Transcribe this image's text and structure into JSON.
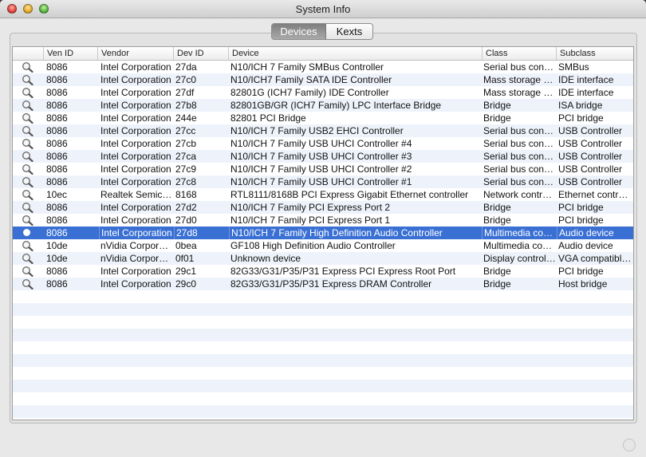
{
  "window": {
    "title": "System Info"
  },
  "tabs": [
    {
      "label": "Devices",
      "active": true
    },
    {
      "label": "Kexts",
      "active": false
    }
  ],
  "table": {
    "columns": [
      "",
      "Ven ID",
      "Vendor",
      "Dev ID",
      "Device",
      "Class",
      "Subclass"
    ],
    "rows": [
      {
        "ven_id": "8086",
        "vendor": "Intel Corporation",
        "dev_id": "27da",
        "device": "N10/ICH 7 Family SMBus Controller",
        "class": "Serial bus controller",
        "subclass": "SMBus"
      },
      {
        "ven_id": "8086",
        "vendor": "Intel Corporation",
        "dev_id": "27c0",
        "device": "N10/ICH7 Family SATA IDE Controller",
        "class": "Mass storage controller",
        "subclass": "IDE interface"
      },
      {
        "ven_id": "8086",
        "vendor": "Intel Corporation",
        "dev_id": "27df",
        "device": "82801G (ICH7 Family) IDE Controller",
        "class": "Mass storage controller",
        "subclass": "IDE interface"
      },
      {
        "ven_id": "8086",
        "vendor": "Intel Corporation",
        "dev_id": "27b8",
        "device": "82801GB/GR (ICH7 Family) LPC Interface Bridge",
        "class": "Bridge",
        "subclass": "ISA bridge"
      },
      {
        "ven_id": "8086",
        "vendor": "Intel Corporation",
        "dev_id": "244e",
        "device": "82801 PCI Bridge",
        "class": "Bridge",
        "subclass": "PCI bridge"
      },
      {
        "ven_id": "8086",
        "vendor": "Intel Corporation",
        "dev_id": "27cc",
        "device": "N10/ICH 7 Family USB2 EHCI Controller",
        "class": "Serial bus controller",
        "subclass": "USB Controller"
      },
      {
        "ven_id": "8086",
        "vendor": "Intel Corporation",
        "dev_id": "27cb",
        "device": "N10/ICH 7 Family USB UHCI Controller #4",
        "class": "Serial bus controller",
        "subclass": "USB Controller"
      },
      {
        "ven_id": "8086",
        "vendor": "Intel Corporation",
        "dev_id": "27ca",
        "device": "N10/ICH 7 Family USB UHCI Controller #3",
        "class": "Serial bus controller",
        "subclass": "USB Controller"
      },
      {
        "ven_id": "8086",
        "vendor": "Intel Corporation",
        "dev_id": "27c9",
        "device": "N10/ICH 7 Family USB UHCI Controller #2",
        "class": "Serial bus controller",
        "subclass": "USB Controller"
      },
      {
        "ven_id": "8086",
        "vendor": "Intel Corporation",
        "dev_id": "27c8",
        "device": "N10/ICH 7 Family USB UHCI Controller #1",
        "class": "Serial bus controller",
        "subclass": "USB Controller"
      },
      {
        "ven_id": "10ec",
        "vendor": "Realtek Semiconductor",
        "dev_id": "8168",
        "device": "RTL8111/8168B PCI Express Gigabit Ethernet controller",
        "class": "Network controller",
        "subclass": "Ethernet controller"
      },
      {
        "ven_id": "8086",
        "vendor": "Intel Corporation",
        "dev_id": "27d2",
        "device": "N10/ICH 7 Family PCI Express Port 2",
        "class": "Bridge",
        "subclass": "PCI bridge"
      },
      {
        "ven_id": "8086",
        "vendor": "Intel Corporation",
        "dev_id": "27d0",
        "device": "N10/ICH 7 Family PCI Express Port 1",
        "class": "Bridge",
        "subclass": "PCI bridge"
      },
      {
        "ven_id": "8086",
        "vendor": "Intel Corporation",
        "dev_id": "27d8",
        "device": "N10/ICH 7 Family High Definition Audio Controller",
        "class": "Multimedia controller",
        "subclass": "Audio device",
        "selected": true
      },
      {
        "ven_id": "10de",
        "vendor": "nVidia Corporation",
        "dev_id": "0bea",
        "device": "GF108 High Definition Audio Controller",
        "class": "Multimedia controller",
        "subclass": "Audio device"
      },
      {
        "ven_id": "10de",
        "vendor": "nVidia Corporation",
        "dev_id": "0f01",
        "device": "Unknown device",
        "class": "Display controller",
        "subclass": "VGA compatible controller"
      },
      {
        "ven_id": "8086",
        "vendor": "Intel Corporation",
        "dev_id": "29c1",
        "device": "82G33/G31/P35/P31 Express PCI Express Root Port",
        "class": "Bridge",
        "subclass": "PCI bridge"
      },
      {
        "ven_id": "8086",
        "vendor": "Intel Corporation",
        "dev_id": "29c0",
        "device": "82G33/G31/P35/P31 Express DRAM Controller",
        "class": "Bridge",
        "subclass": "Host bridge"
      }
    ]
  },
  "colors": {
    "selection": "#3a70d4",
    "alt_row": "#eef3fb"
  },
  "icons": {
    "row_action": "magnifier-icon",
    "selected_row_action": "circle-icon"
  }
}
